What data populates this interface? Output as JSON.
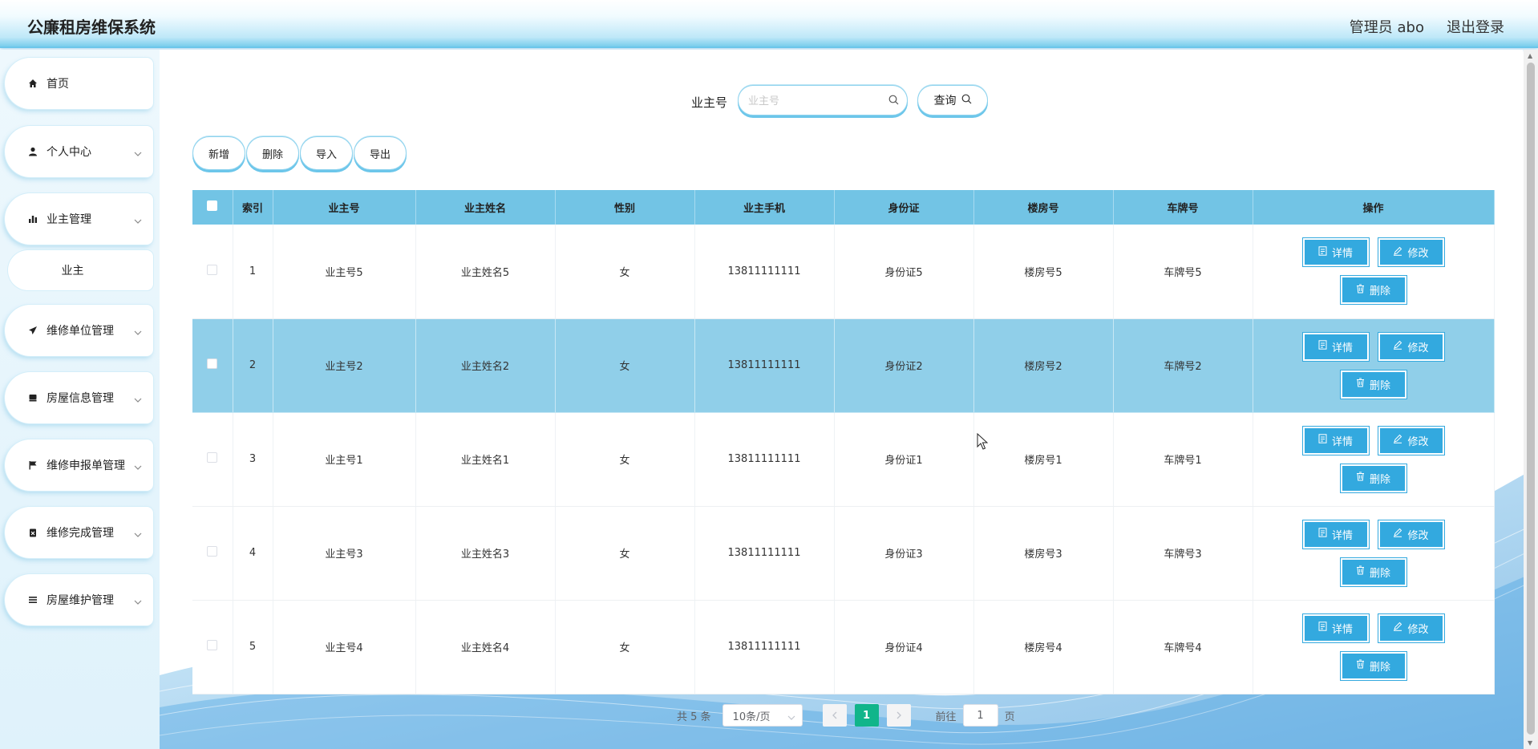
{
  "header": {
    "app_title": "公廉租房维保系统",
    "user_label": "管理员 abo",
    "logout_label": "退出登录"
  },
  "sidebar": {
    "items": [
      {
        "label": "首页",
        "icon": "home-icon"
      },
      {
        "label": "个人中心",
        "icon": "user-icon"
      },
      {
        "label": "业主管理",
        "icon": "bar-chart-icon"
      },
      {
        "label": "维修单位管理",
        "icon": "paper-plane-icon"
      },
      {
        "label": "房屋信息管理",
        "icon": "inbox-icon"
      },
      {
        "label": "维修申报单管理",
        "icon": "flag-icon"
      },
      {
        "label": "维修完成管理",
        "icon": "clipboard-icon"
      },
      {
        "label": "房屋维护管理",
        "icon": "list-icon"
      }
    ],
    "submenu": {
      "label": "业主"
    }
  },
  "search": {
    "label": "业主号",
    "placeholder": "业主号",
    "query_label": "查询"
  },
  "toolbar": {
    "add_label": "新增",
    "delete_label": "删除",
    "import_label": "导入",
    "export_label": "导出"
  },
  "table": {
    "columns": [
      "索引",
      "业主号",
      "业主姓名",
      "性别",
      "业主手机",
      "身份证",
      "楼房号",
      "车牌号",
      "操作"
    ],
    "rows": [
      {
        "index": "1",
        "owner_no": "业主号5",
        "owner_name": "业主姓名5",
        "gender": "女",
        "phone": "13811111111",
        "id_card": "身份证5",
        "building": "楼房号5",
        "plate": "车牌号5",
        "selected": false
      },
      {
        "index": "2",
        "owner_no": "业主号2",
        "owner_name": "业主姓名2",
        "gender": "女",
        "phone": "13811111111",
        "id_card": "身份证2",
        "building": "楼房号2",
        "plate": "车牌号2",
        "selected": true
      },
      {
        "index": "3",
        "owner_no": "业主号1",
        "owner_name": "业主姓名1",
        "gender": "女",
        "phone": "13811111111",
        "id_card": "身份证1",
        "building": "楼房号1",
        "plate": "车牌号1",
        "selected": false
      },
      {
        "index": "4",
        "owner_no": "业主号3",
        "owner_name": "业主姓名3",
        "gender": "女",
        "phone": "13811111111",
        "id_card": "身份证3",
        "building": "楼房号3",
        "plate": "车牌号3",
        "selected": false
      },
      {
        "index": "5",
        "owner_no": "业主号4",
        "owner_name": "业主姓名4",
        "gender": "女",
        "phone": "13811111111",
        "id_card": "身份证4",
        "building": "楼房号4",
        "plate": "车牌号4",
        "selected": false
      }
    ],
    "actions": {
      "detail": "详情",
      "edit": "修改",
      "delete": "删除"
    }
  },
  "pagination": {
    "total_text": "共 5 条",
    "page_size": "10条/页",
    "current_page": "1",
    "goto_prefix": "前往",
    "goto_value": "1",
    "goto_suffix": "页"
  },
  "colors": {
    "accent": "#33a9df",
    "header_row": "#72c4e5",
    "selected_row": "#90cfe9",
    "page_active": "#11b58a"
  }
}
